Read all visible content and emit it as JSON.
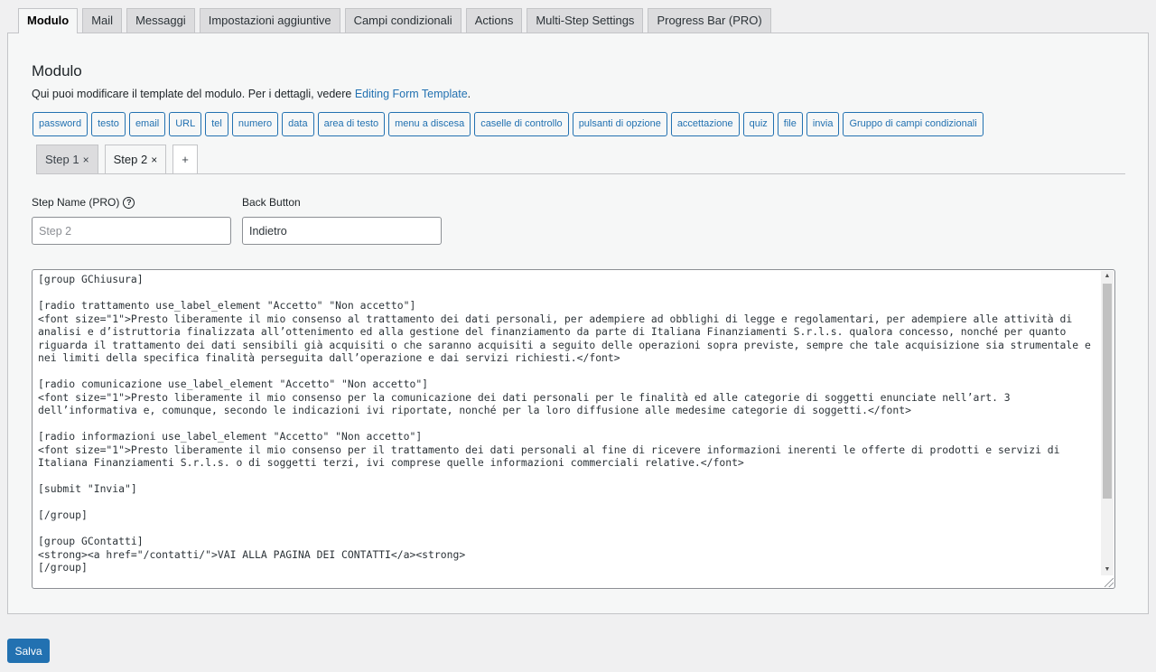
{
  "tabs": [
    {
      "label": "Modulo",
      "active": true
    },
    {
      "label": "Mail"
    },
    {
      "label": "Messaggi"
    },
    {
      "label": "Impostazioni aggiuntive"
    },
    {
      "label": "Campi condizionali"
    },
    {
      "label": "Actions"
    },
    {
      "label": "Multi-Step Settings"
    },
    {
      "label": "Progress Bar (PRO)"
    }
  ],
  "panel": {
    "title": "Modulo",
    "description": "Qui puoi modificare il template del modulo. Per i dettagli, vedere ",
    "description_link": "Editing Form Template",
    "description_end": "."
  },
  "tags": [
    "password",
    "testo",
    "email",
    "URL",
    "tel",
    "numero",
    "data",
    "area di testo",
    "menu a discesa",
    "caselle di controllo",
    "pulsanti di opzione",
    "accettazione",
    "quiz",
    "file",
    "invia",
    "Gruppo di campi condizionali"
  ],
  "steps": [
    {
      "label": "Step 1",
      "close": "×"
    },
    {
      "label": "Step 2",
      "close": "×",
      "active": true
    }
  ],
  "add_step_label": "+",
  "step_name": {
    "label": "Step Name (PRO)",
    "help": "?",
    "placeholder": "Step 2"
  },
  "back_button": {
    "label": "Back Button",
    "value": "Indietro"
  },
  "editor": {
    "content": "[group GChiusura]\n\n[radio trattamento use_label_element \"Accetto\" \"Non accetto\"]\n<font size=\"1\">Presto liberamente il mio consenso al trattamento dei dati personali, per adempiere ad obblighi di legge e regolamentari, per adempiere alle attività di analisi e d’istruttoria finalizzata all’ottenimento ed alla gestione del finanziamento da parte di Italiana Finanziamenti S.r.l.s. qualora concesso, nonché per quanto riguarda il trattamento dei dati sensibili già acquisiti o che saranno acquisiti a seguito delle operazioni sopra previste, sempre che tale acquisizione sia strumentale e nei limiti della specifica finalità perseguita dall’operazione e dai servizi richiesti.</font>\n\n[radio comunicazione use_label_element \"Accetto\" \"Non accetto\"]\n<font size=\"1\">Presto liberamente il mio consenso per la comunicazione dei dati personali per le finalità ed alle categorie di soggetti enunciate nell’art. 3\ndell’informativa e, comunque, secondo le indicazioni ivi riportate, nonché per la loro diffusione alle medesime categorie di soggetti.</font>\n\n[radio informazioni use_label_element \"Accetto\" \"Non accetto\"]\n<font size=\"1\">Presto liberamente il mio consenso per il trattamento dei dati personali al fine di ricevere informazioni inerenti le offerte di prodotti e servizi di Italiana Finanziamenti S.r.l.s. o di soggetti terzi, ivi comprese quelle informazioni commerciali relative.</font>\n\n[submit \"Invia\"]\n\n[/group]\n\n[group GContatti]\n<strong><a href=\"/contatti/\">VAI ALLA PAGINA DEI CONTATTI</a><strong>\n[/group]"
  },
  "save_label": "Salva"
}
